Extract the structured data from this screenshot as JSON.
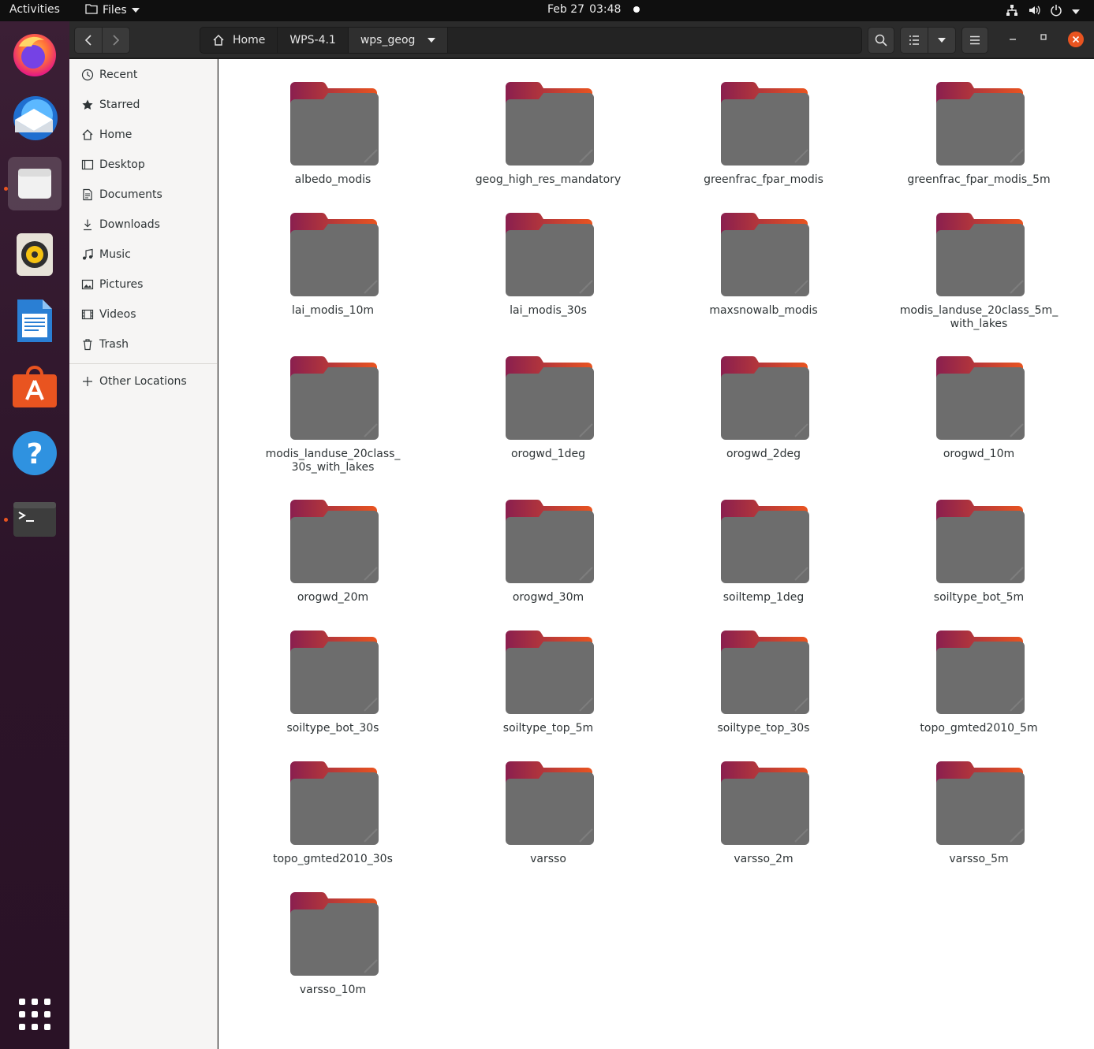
{
  "topbar": {
    "activities": "Activities",
    "app_name": "Files",
    "date": "Feb 27",
    "time": "03:48"
  },
  "dock": {
    "apps": [
      "firefox-icon",
      "thunderbird-icon",
      "files-icon",
      "rhythmbox-icon",
      "libreoffice-writer-icon",
      "ubuntu-software-icon",
      "help-icon",
      "terminal-icon"
    ],
    "show_apps": "show-applications-icon"
  },
  "header": {
    "breadcrumbs": [
      "Home",
      "WPS-4.1",
      "wps_geog"
    ]
  },
  "sidebar": {
    "items": [
      {
        "label": "Recent",
        "icon": "clock-icon"
      },
      {
        "label": "Starred",
        "icon": "star-icon"
      },
      {
        "label": "Home",
        "icon": "home-icon"
      },
      {
        "label": "Desktop",
        "icon": "desktop-icon"
      },
      {
        "label": "Documents",
        "icon": "document-icon"
      },
      {
        "label": "Downloads",
        "icon": "download-icon"
      },
      {
        "label": "Music",
        "icon": "music-icon"
      },
      {
        "label": "Pictures",
        "icon": "picture-icon"
      },
      {
        "label": "Videos",
        "icon": "video-icon"
      },
      {
        "label": "Trash",
        "icon": "trash-icon"
      }
    ],
    "other_locations": "Other Locations"
  },
  "folders": [
    "albedo_modis",
    "geog_high_res_mandatory",
    "greenfrac_fpar_modis",
    "greenfrac_fpar_modis_5m",
    "lai_modis_10m",
    "lai_modis_30s",
    "maxsnowalb_modis",
    "modis_landuse_20class_5m_\nwith_lakes",
    "modis_landuse_20class_\n30s_with_lakes",
    "orogwd_1deg",
    "orogwd_2deg",
    "orogwd_10m",
    "orogwd_20m",
    "orogwd_30m",
    "soiltemp_1deg",
    "soiltype_bot_5m",
    "soiltype_bot_30s",
    "soiltype_top_5m",
    "soiltype_top_30s",
    "topo_gmted2010_5m",
    "topo_gmted2010_30s",
    "varsso",
    "varsso_2m",
    "varsso_5m",
    "varsso_10m"
  ],
  "colors": {
    "accent": "#e95420",
    "folder_body": "#6d6d6d",
    "folder_tab_start": "#8a1f4f",
    "folder_tab_end": "#e95420"
  }
}
